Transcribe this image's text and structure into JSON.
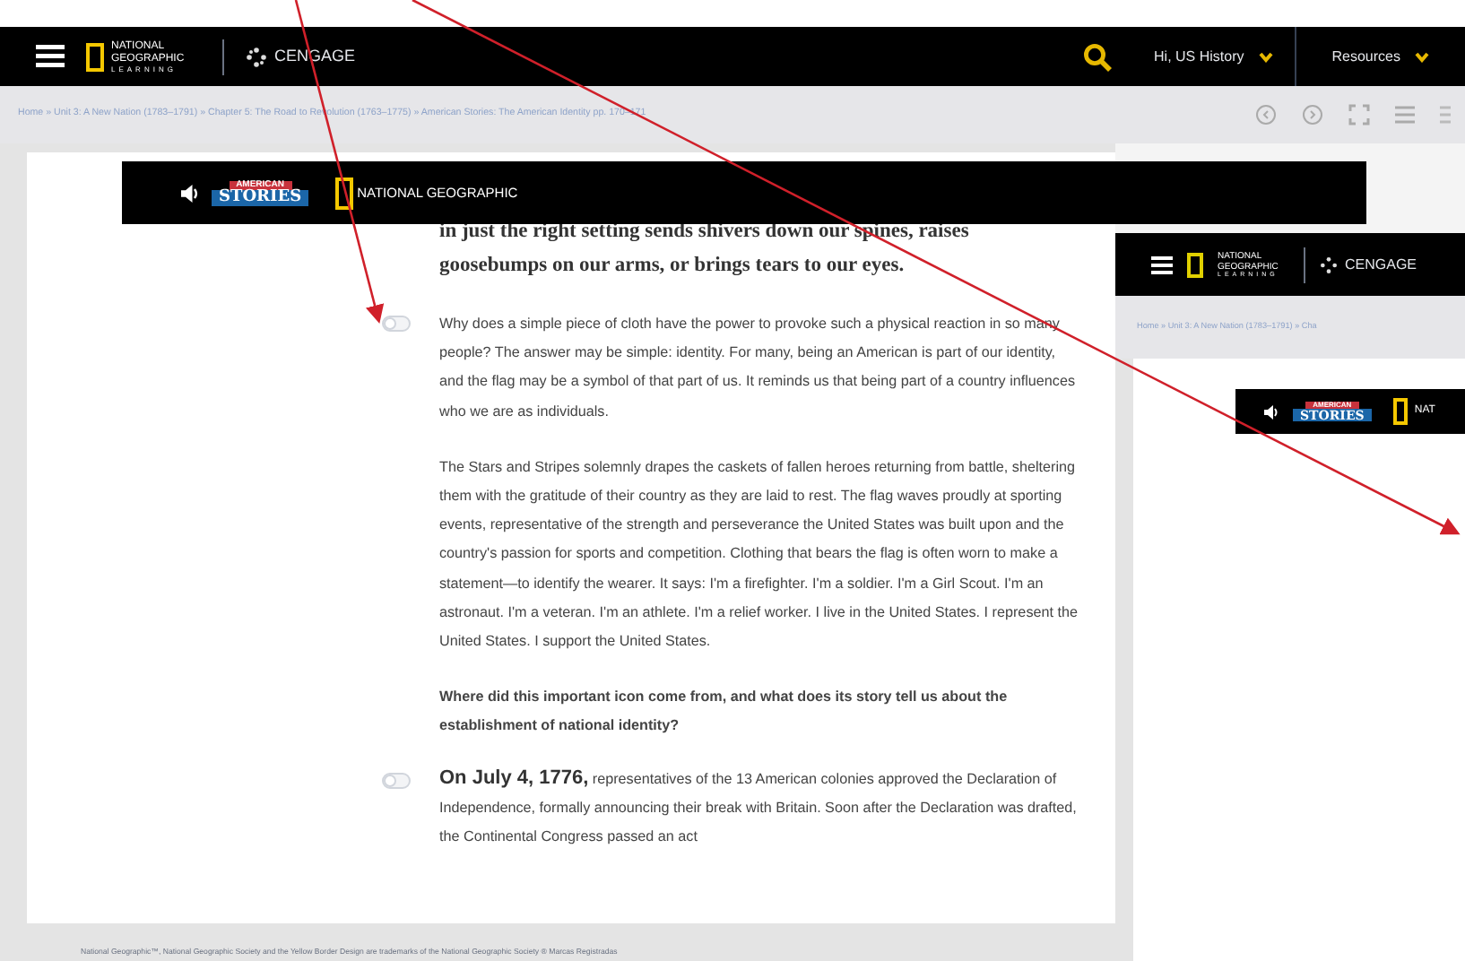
{
  "header": {
    "brand": "NATIONAL GEOGRAPHIC",
    "brand_sub": "LEARNING",
    "publisher": "CENGAGE",
    "user_menu": "Hi, US History",
    "resources_menu": "Resources"
  },
  "breadcrumb": "Home » Unit 3: A New Nation (1783–1791) » Chapter 5: The Road to Revolution (1763–1775) » American Stories: The American Identity pp. 170–171",
  "banner": {
    "badge_top": "AMERICAN",
    "badge_bottom": "STORIES",
    "brand": "NATIONAL GEOGRAPHIC"
  },
  "article": {
    "intro": "in just the right setting sends shivers down our spines, raises goosebumps on our arms, or brings tears to our eyes.",
    "blocks": [
      {
        "kind": "paragraph",
        "note_toggle": false,
        "text": "Why does a simple piece of cloth have the power to provoke such a physical reaction in so many people? The answer may be simple: identity. For many, being an American is part of our identity, and the flag may be a symbol of that part of us. It reminds us that being part of a country influences who we are as individuals."
      },
      {
        "kind": "paragraph",
        "text": "The Stars and Stripes solemnly drapes the caskets of fallen heroes returning from battle, sheltering them with the gratitude of their country as they are laid to rest. The flag waves proudly at sporting events, representative of the strength and perseverance the United States was built upon and the country's passion for sports and competition. Clothing that bears the flag is often worn to make a statement—to identify the wearer. It says: I'm a firefighter. I'm a soldier. I'm a Girl Scout. I'm an astronaut. I'm a veteran. I'm an athlete. I'm a relief worker. I live in the United States. I represent the United States. I support the United States."
      },
      {
        "kind": "question",
        "text": "Where did this important icon come from, and what does its story tell us about the establishment of national identity?"
      },
      {
        "kind": "lead",
        "note_toggle": false,
        "lead": "On July 4, 1776,",
        "text": "representatives of the 13 American colonies approved the Declaration of Independence, formally announcing their break with Britain. Soon after the Declaration was drafted, the Continental Congress passed an act"
      }
    ]
  },
  "footer": "National Geographic™, National Geographic Society and the Yellow Border Design are trademarks of the National Geographic Society ® Marcas Registradas",
  "inset": {
    "brand": "NATIONAL GEOGRAPHIC",
    "brand_sub": "LEARNING",
    "publisher": "CENGAGE",
    "breadcrumb": "Home » Unit 3: A New Nation (1783–1791) » Cha",
    "badge_top": "AMERICAN",
    "badge_bottom": "STORIES",
    "brand_cut": "NAT"
  }
}
